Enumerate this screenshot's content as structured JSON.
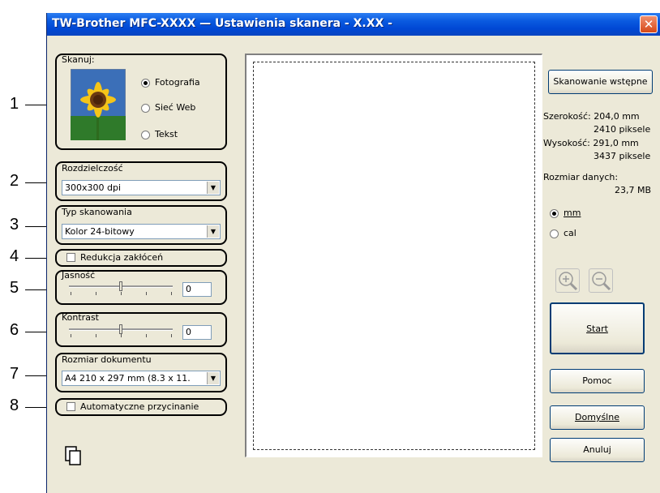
{
  "callouts": [
    "1",
    "2",
    "3",
    "4",
    "5",
    "6",
    "7",
    "8"
  ],
  "window": {
    "title": "TW-Brother MFC-XXXX — Ustawienia skanera - X.XX -"
  },
  "scan_group": {
    "label": "Skanuj:",
    "options": [
      "Fotografia",
      "Sieć Web",
      "Tekst"
    ],
    "selected": "Fotografia"
  },
  "resolution": {
    "label": "Rozdzielczość",
    "value": "300x300 dpi"
  },
  "scan_type": {
    "label": "Typ skanowania",
    "value": "Kolor 24-bitowy"
  },
  "noise": {
    "label": "Redukcja zakłóceń",
    "checked": false
  },
  "brightness": {
    "label": "Jasność",
    "value": "0",
    "level": 0
  },
  "contrast": {
    "label": "Kontrast",
    "value": "0",
    "level": 0
  },
  "doc_size": {
    "label": "Rozmiar dokumentu",
    "value": "A4 210 x 297 mm (8.3 x 11."
  },
  "autocrop": {
    "label": "Automatyczne przycinanie",
    "checked": false
  },
  "buttons": {
    "prescan": "Skanowanie wstępne",
    "start": "Start",
    "help": "Pomoc",
    "defaults": "Domyślne",
    "cancel": "Anuluj"
  },
  "info": {
    "width_label": "Szerokość: 204,0 mm",
    "width_px": "2410 piksele",
    "height_label": "Wysokość: 291,0 mm",
    "height_px": "3437 piksele",
    "size_label": "Rozmiar danych:",
    "size_value": "23,7 MB"
  },
  "units": {
    "options": [
      "mm",
      "cal"
    ],
    "selected": "mm"
  },
  "icons": [
    "sunflower-photo-icon",
    "zoom-in-icon",
    "zoom-out-icon",
    "copy-pages-icon",
    "close-icon"
  ],
  "colors": {
    "titlebar": "#0a5ae0",
    "dialog_bg": "#ece9d8",
    "close": "#d64818"
  }
}
